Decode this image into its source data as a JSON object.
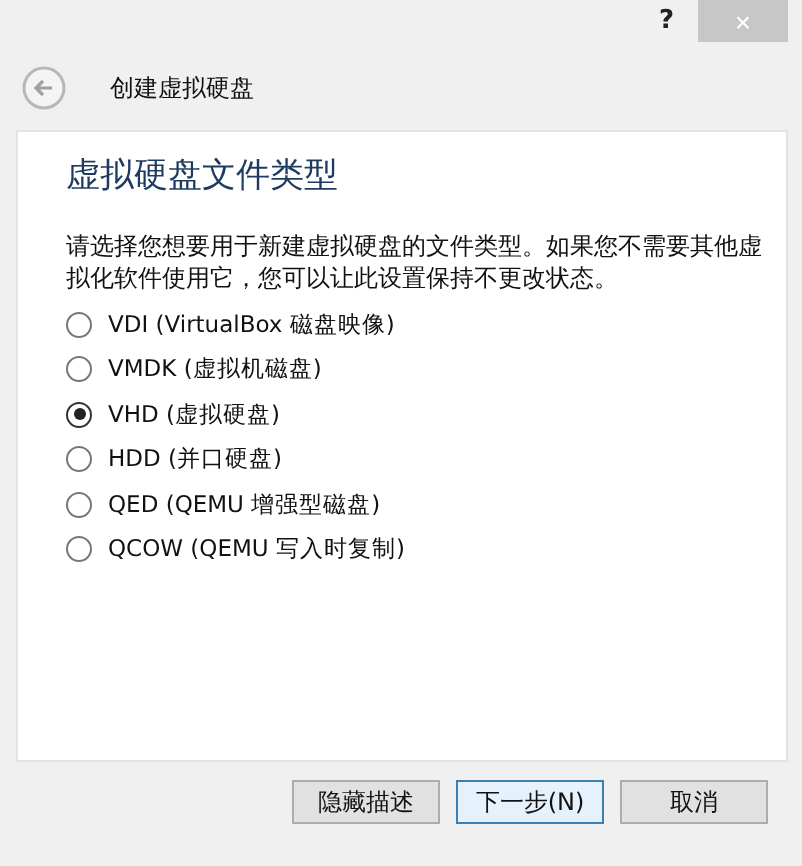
{
  "window": {
    "help": "?",
    "close": "×"
  },
  "header": {
    "title": "创建虚拟硬盘"
  },
  "page": {
    "heading": "虚拟硬盘文件类型",
    "description": "请选择您想要用于新建虚拟硬盘的文件类型。如果您不需要其他虚拟化软件使用它，您可以让此设置保持不更改状态。"
  },
  "options": [
    {
      "label": "VDI (VirtualBox 磁盘映像)",
      "selected": false
    },
    {
      "label": "VMDK (虚拟机磁盘)",
      "selected": false
    },
    {
      "label": "VHD (虚拟硬盘)",
      "selected": true
    },
    {
      "label": "HDD (并口硬盘)",
      "selected": false
    },
    {
      "label": "QED (QEMU 增强型磁盘)",
      "selected": false
    },
    {
      "label": "QCOW (QEMU 写入时复制)",
      "selected": false
    }
  ],
  "buttons": [
    {
      "label": "隐藏描述",
      "focused": false
    },
    {
      "label": "下一步(N)",
      "focused": true
    },
    {
      "label": "取消",
      "focused": false
    }
  ]
}
